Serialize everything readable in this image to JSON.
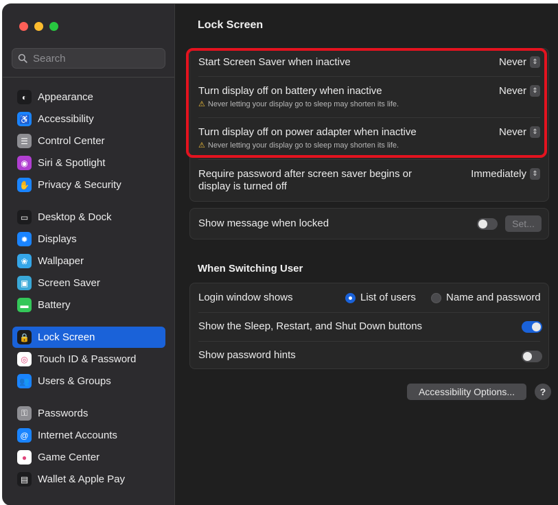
{
  "window": {
    "traffic_lights": [
      {
        "name": "close",
        "color": "#ff5f57"
      },
      {
        "name": "minimize",
        "color": "#febc2e"
      },
      {
        "name": "zoom",
        "color": "#28c840"
      }
    ]
  },
  "sidebar": {
    "search_placeholder": "Search",
    "items": [
      {
        "label": "Appearance",
        "icon": "appearance-icon",
        "icon_color": "#1c1c1e",
        "glyph": "◐",
        "active": false
      },
      {
        "label": "Accessibility",
        "icon": "accessibility-icon",
        "icon_color": "#1a84ff",
        "glyph": "♿",
        "active": false
      },
      {
        "label": "Control Center",
        "icon": "control-center-icon",
        "icon_color": "#8e8e93",
        "glyph": "☰",
        "active": false
      },
      {
        "label": "Siri & Spotlight",
        "icon": "siri-icon",
        "icon_color": "#b13fd1",
        "glyph": "◉",
        "active": false
      },
      {
        "label": "Privacy & Security",
        "icon": "hand-icon",
        "icon_color": "#1a84ff",
        "glyph": "✋",
        "active": false
      },
      {
        "label": "Desktop & Dock",
        "icon": "dock-icon",
        "icon_color": "#1c1c1e",
        "glyph": "▭",
        "active": false
      },
      {
        "label": "Displays",
        "icon": "displays-icon",
        "icon_color": "#1a84ff",
        "glyph": "✹",
        "active": false
      },
      {
        "label": "Wallpaper",
        "icon": "wallpaper-icon",
        "icon_color": "#35a6e8",
        "glyph": "❀",
        "active": false
      },
      {
        "label": "Screen Saver",
        "icon": "screen-saver-icon",
        "icon_color": "#3aa8d8",
        "glyph": "▣",
        "active": false
      },
      {
        "label": "Battery",
        "icon": "battery-icon",
        "icon_color": "#34c759",
        "glyph": "▬",
        "active": false
      },
      {
        "label": "Lock Screen",
        "icon": "lock-icon",
        "icon_color": "#1c1c1e",
        "glyph": "🔒",
        "active": true
      },
      {
        "label": "Touch ID & Password",
        "icon": "fingerprint-icon",
        "icon_color": "#ffffff",
        "glyph": "◎",
        "active": false
      },
      {
        "label": "Users & Groups",
        "icon": "users-icon",
        "icon_color": "#1a84ff",
        "glyph": "👥",
        "active": false
      },
      {
        "label": "Passwords",
        "icon": "key-icon",
        "icon_color": "#8e8e93",
        "glyph": "⚿",
        "active": false
      },
      {
        "label": "Internet Accounts",
        "icon": "at-icon",
        "icon_color": "#1a84ff",
        "glyph": "@",
        "active": false
      },
      {
        "label": "Game Center",
        "icon": "game-center-icon",
        "icon_color": "#ffffff",
        "glyph": "●",
        "active": false
      },
      {
        "label": "Wallet & Apple Pay",
        "icon": "wallet-icon",
        "icon_color": "#1c1c1e",
        "glyph": "▤",
        "active": false
      }
    ]
  },
  "main": {
    "title": "Lock Screen",
    "screen_saver": {
      "label": "Start Screen Saver when inactive",
      "value": "Never"
    },
    "display_battery": {
      "label": "Turn display off on battery when inactive",
      "value": "Never",
      "warning": "Never letting your display go to sleep may shorten its life."
    },
    "display_power": {
      "label": "Turn display off on power adapter when inactive",
      "value": "Never",
      "warning": "Never letting your display go to sleep may shorten its life."
    },
    "require_password": {
      "label_line1": "Require password after screen saver begins or",
      "label_line2": "display is turned off",
      "value": "Immediately"
    },
    "show_message": {
      "label": "Show message when locked",
      "toggle_on": false,
      "set_button": "Set..."
    },
    "switching_section_title": "When Switching User",
    "login_window": {
      "label": "Login window shows",
      "option_list": "List of users",
      "option_name": "Name and password",
      "selected": "List of users"
    },
    "show_sleep_buttons": {
      "label": "Show the Sleep, Restart, and Shut Down buttons",
      "toggle_on": true
    },
    "password_hints": {
      "label": "Show password hints",
      "toggle_on": false
    },
    "accessibility_options_button": "Accessibility Options...",
    "help_button": "?"
  },
  "colors": {
    "accent": "#1a62d9",
    "highlight_border": "#e3131f",
    "warning": "#f2c13b"
  }
}
